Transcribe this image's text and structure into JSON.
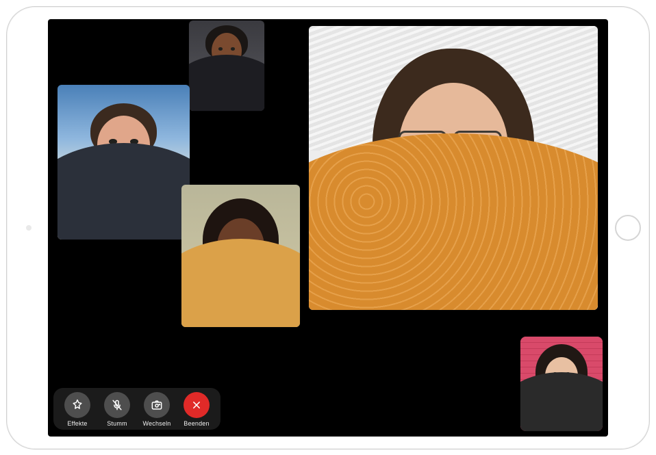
{
  "participants": {
    "top": {
      "bg": "linear-gradient(#3a3a3f,#5a5a60)",
      "skin": "#7a4a2f",
      "hair": "#1a1614",
      "shirt": "#1d1d22"
    },
    "left": {
      "bg": "linear-gradient(#4a80b8 0%, #8fb7de 35%, #f3f0df 70%)",
      "skin": "#e0a68a",
      "hair": "#3b2a1f",
      "shirt": "#2b303a"
    },
    "mid": {
      "bg": "linear-gradient(#b9b699,#d2caa6)",
      "skin": "#6a3e28",
      "hair": "#1e1410",
      "shirt": "#dba149"
    },
    "right": {
      "bg": "#ededed",
      "skin": "#e6b99a",
      "hair": "#3c2a1d",
      "shirt": "#d88b2e"
    },
    "self": {
      "bg": "linear-gradient(#d94a6a,#d94a6a)",
      "skin": "#e8c0a2",
      "hair": "#201814",
      "shirt": "#2a2a2a"
    }
  },
  "controls": {
    "effects": "Effekte",
    "mute": "Stumm",
    "flip": "Wechseln",
    "end": "Beenden"
  },
  "colors": {
    "end_button": "#e02a28"
  }
}
